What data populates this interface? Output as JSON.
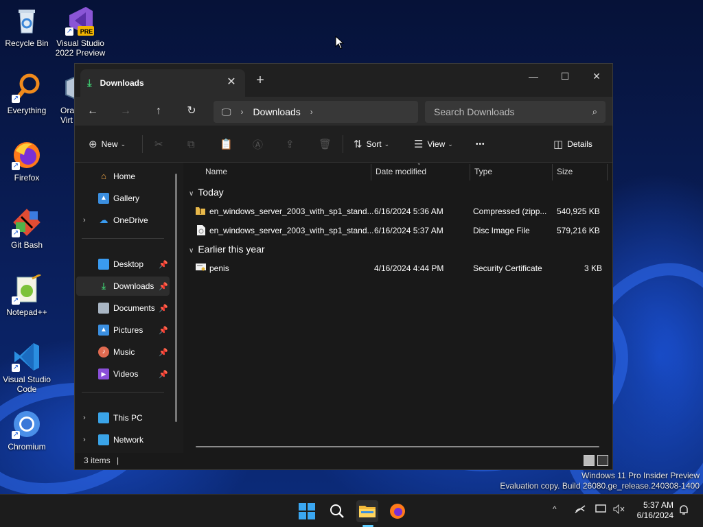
{
  "desktop": {
    "icons": [
      {
        "label": "Recycle Bin"
      },
      {
        "label": "Visual Studio 2022 Preview",
        "badge": "PRE"
      },
      {
        "label": "Everything"
      },
      {
        "label": "Ora Virt"
      },
      {
        "label": "Firefox"
      },
      {
        "label": "Git Bash"
      },
      {
        "label": "Notepad++"
      },
      {
        "label": "Visual Studio Code"
      },
      {
        "label": "Chromium"
      }
    ]
  },
  "explorer": {
    "tab": {
      "title": "Downloads",
      "close": "✕",
      "new_tab": "+"
    },
    "window_buttons": {
      "minimize": "—",
      "maximize": "☐",
      "close": "✕"
    },
    "nav": {
      "back": "←",
      "forward": "→",
      "up": "↑",
      "refresh": "↻"
    },
    "address": {
      "location_icon": "🖵",
      "sep1": "›",
      "crumb": "Downloads",
      "sep2": "›"
    },
    "search": {
      "placeholder": "Search Downloads",
      "icon": "⌕"
    },
    "toolbar": {
      "new_label": "New",
      "sort_label": "Sort",
      "view_label": "View",
      "more_label": "•••",
      "details_label": "Details"
    },
    "sidebar": {
      "items": [
        {
          "label": "Home",
          "icon": "home-icon"
        },
        {
          "label": "Gallery",
          "icon": "gallery-icon"
        },
        {
          "label": "OneDrive",
          "icon": "cloud-icon"
        },
        {
          "label": "Desktop",
          "icon": "desktop-icon"
        },
        {
          "label": "Downloads",
          "icon": "download-icon"
        },
        {
          "label": "Documents",
          "icon": "documents-icon"
        },
        {
          "label": "Pictures",
          "icon": "pictures-icon"
        },
        {
          "label": "Music",
          "icon": "music-icon"
        },
        {
          "label": "Videos",
          "icon": "videos-icon"
        },
        {
          "label": "This PC",
          "icon": "pc-icon"
        },
        {
          "label": "Network",
          "icon": "network-icon"
        }
      ]
    },
    "columns": {
      "name": "Name",
      "date": "Date modified",
      "type": "Type",
      "size": "Size"
    },
    "groups": [
      {
        "label": "Today",
        "rows": [
          {
            "name": "en_windows_server_2003_with_sp1_stand...",
            "date": "6/16/2024 5:36 AM",
            "type": "Compressed (zipp...",
            "size": "540,925 KB",
            "icon": "zip-folder-icon"
          },
          {
            "name": "en_windows_server_2003_with_sp1_stand...",
            "date": "6/16/2024 5:37 AM",
            "type": "Disc Image File",
            "size": "579,216 KB",
            "icon": "disc-image-icon"
          }
        ]
      },
      {
        "label": "Earlier this year",
        "rows": [
          {
            "name": "penis",
            "date": "4/16/2024 4:44 PM",
            "type": "Security Certificate",
            "size": "3 KB",
            "icon": "certificate-icon"
          }
        ]
      }
    ],
    "status": {
      "count": "3 items",
      "cursor": "|"
    }
  },
  "watermark": {
    "line1": "Windows 11 Pro Insider Preview",
    "line2": "Evaluation copy. Build 26080.ge_release.240308-1400"
  },
  "taskbar": {
    "clock_time": "5:37 AM",
    "clock_date": "6/16/2024",
    "tray_chevron": "^"
  },
  "colors": {
    "accent": "#60cdff",
    "window_bg": "#191919",
    "download_green": "#3ec46d"
  }
}
